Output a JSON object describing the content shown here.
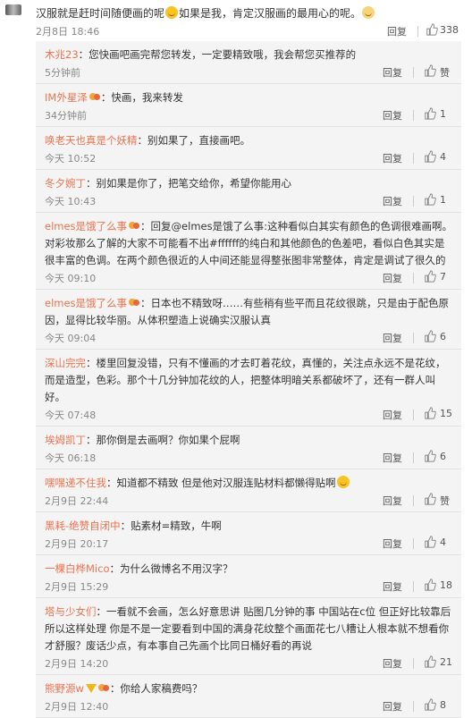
{
  "top_comment": {
    "text_a": "汉服就是赶时间随便画的呢",
    "text_b": "如果是我，肯定汉服画的最用心的呢。",
    "time": "2月8日 18:46",
    "reply": "回复",
    "likes": "338"
  },
  "comments": [
    {
      "name": "木兆23",
      "text": "：您快画吧画完帮您转发，一定要精致哦，我会帮您买推荐的",
      "time": "5分钟前",
      "reply": "回复",
      "likes": "赞"
    },
    {
      "name": "IM外星泽",
      "text": "：快画，我来转发",
      "time": "34分钟前",
      "reply": "回复",
      "likes": "1"
    },
    {
      "name": "唤老天也真是个妖精",
      "text": "：别如果了，直接画吧。",
      "time": "今天 10:52",
      "reply": "回复",
      "likes": "4"
    },
    {
      "name": "冬夕婉丁",
      "text": "：别如果是你了，把笔交给你，希望你能用心",
      "time": "今天 10:43",
      "reply": "回复",
      "likes": "1"
    },
    {
      "name": "elmes是饿了么事",
      "text": "：回复@elmes是饿了么事:这种看似白其实有颜色的色调很难画啊。对彩妆那么了解的大家不可能看不出#ffffff的纯白和其他颜色的色差吧，看似白色其实是很丰富的色调。在两个颜色很近的人中间还能显得整张图非常整体，肯定是调试了很久的",
      "time": "今天 09:10",
      "reply": "回复",
      "likes": "7"
    },
    {
      "name": "elmes是饿了么事",
      "text": "：日本也不精致呀……有些稍有些平而且花纹很跳，只是由于配色原因，显得比较华丽。从体积塑造上说确实汉服认真",
      "time": "今天 09:04",
      "reply": "回复",
      "likes": "6"
    },
    {
      "name": "深山完完",
      "text": "：楼里回复没错，只有不懂画的才去盯着花纹，真懂的，关注点永远不是花纹，而是造型，色彩。那个十几分钟加花纹的人，把整体明暗关系都破坏了，还有一群人叫好。",
      "time": "今天 07:48",
      "reply": "回复",
      "likes": "15"
    },
    {
      "name": "埃姆凯丁",
      "text": "：那你倒是去画啊？你如果个屁啊",
      "time": "今天 06:18",
      "reply": "回复",
      "likes": "6"
    },
    {
      "name": "嘿嘿递不住我",
      "text": "：知道都不精致 但是他对汉服连贴材料都懒得贴啊",
      "time": "2月9日 22:44",
      "reply": "回复",
      "likes": "赞"
    },
    {
      "name": "黑耗-绝赞自闭中",
      "text": "：贴素材=精致，牛啊",
      "time": "2月9日 20:17",
      "reply": "回复",
      "likes": "4"
    },
    {
      "name": "一棵白桦Mico",
      "text": "：为什么微博名不用汉字？",
      "time": "2月9日 15:29",
      "reply": "回复",
      "likes": "18"
    },
    {
      "name": "塔与少女们",
      "text": "：一看就不会画，怎么好意思讲 贴图几分钟的事 中国站在c位 但正好比较靠后所以这样处理 你是不是一定要看到中国的满身花纹整个画面花七八糟让人根本就不想看你才舒服？废话少点，有本事自己先画个比同日桶好看的再说",
      "time": "2月9日 14:20",
      "reply": "回复",
      "likes": "21"
    },
    {
      "name": "熊野源w",
      "text": "：你给人家稿费吗？",
      "time": "2月9日 12:40",
      "reply": "回复",
      "likes": "8"
    }
  ]
}
